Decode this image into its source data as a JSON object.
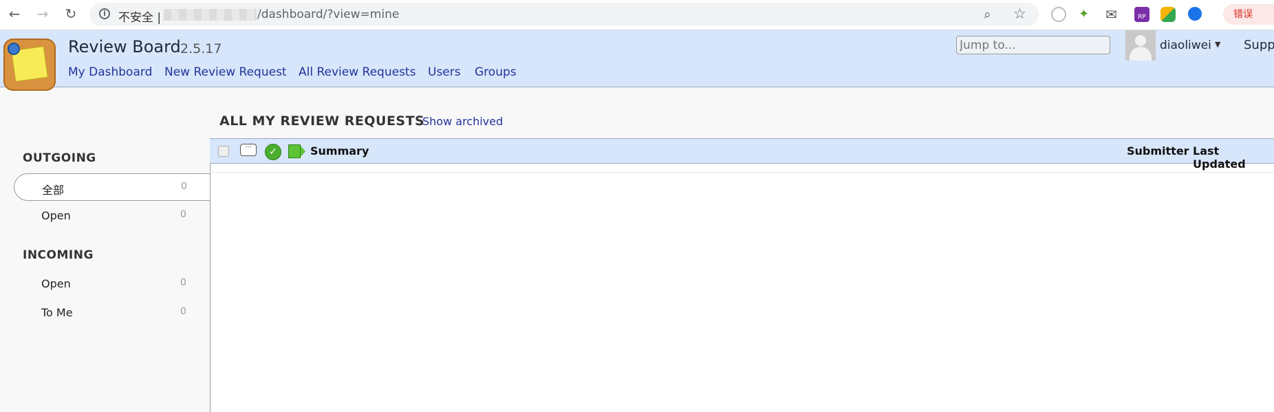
{
  "browser": {
    "insecure_label": "不安全 |",
    "url_path": "/dashboard/?view=mine",
    "extensions": [
      "reader-icon",
      "bird-icon",
      "mail-icon",
      "rp-icon",
      "bolt-icon",
      "target-icon"
    ],
    "error_label": "错误"
  },
  "header": {
    "title": "Review Board",
    "version": "2.5.17",
    "nav": [
      "My Dashboard",
      "New Review Request",
      "All Review Requests",
      "Users",
      "Groups"
    ],
    "jump_placeholder": "Jump to...",
    "username": "diaoliwei",
    "support": "Supp"
  },
  "sidebar": {
    "outgoing_title": "OUTGOING",
    "outgoing": [
      {
        "label": "全部",
        "count": "0"
      },
      {
        "label": "Open",
        "count": "0"
      }
    ],
    "incoming_title": "INCOMING",
    "incoming": [
      {
        "label": "Open",
        "count": "0"
      },
      {
        "label": "To Me",
        "count": "0"
      }
    ]
  },
  "main": {
    "title": "ALL MY REVIEW REQUESTS",
    "show_archived": "Show archived",
    "columns": {
      "summary": "Summary",
      "submitter": "Submitter",
      "last_updated": "Last Updated"
    }
  }
}
